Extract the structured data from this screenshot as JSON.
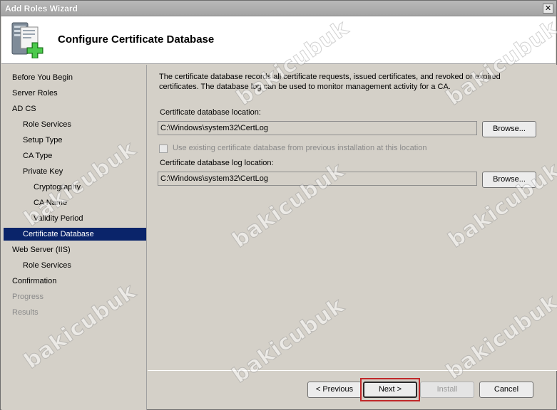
{
  "window": {
    "title": "Add Roles Wizard",
    "close_glyph": "✕"
  },
  "header": {
    "title": "Configure Certificate Database",
    "icon": "server-role-add-icon"
  },
  "sidebar": {
    "items": [
      {
        "label": "Before You Begin",
        "state": "normal"
      },
      {
        "label": "Server Roles",
        "state": "normal"
      },
      {
        "label": "AD CS",
        "state": "normal"
      },
      {
        "label": "Role Services",
        "state": "normal"
      },
      {
        "label": "Setup Type",
        "state": "normal"
      },
      {
        "label": "CA Type",
        "state": "normal"
      },
      {
        "label": "Private Key",
        "state": "normal"
      },
      {
        "label": "Cryptography",
        "state": "normal"
      },
      {
        "label": "CA Name",
        "state": "normal"
      },
      {
        "label": "Validity Period",
        "state": "normal"
      },
      {
        "label": "Certificate Database",
        "state": "selected"
      },
      {
        "label": "Web Server (IIS)",
        "state": "normal"
      },
      {
        "label": "Role Services",
        "state": "normal"
      },
      {
        "label": "Confirmation",
        "state": "normal"
      },
      {
        "label": "Progress",
        "state": "disabled"
      },
      {
        "label": "Results",
        "state": "disabled"
      }
    ]
  },
  "main": {
    "description": "The certificate database records all certificate requests, issued certificates, and revoked or expired certificates. The database log can be used to monitor management activity for a CA.",
    "db_location_label": "Certificate database location:",
    "db_location_value": "C:\\Windows\\system32\\CertLog",
    "browse_label": "Browse...",
    "use_existing_label": "Use existing certificate database from previous installation at this location",
    "log_location_label": "Certificate database log location:",
    "log_location_value": "C:\\Windows\\system32\\CertLog"
  },
  "footer": {
    "previous_label": "< Previous",
    "next_label": "Next >",
    "install_label": "Install",
    "cancel_label": "Cancel"
  },
  "watermark": {
    "text": "bakicubuk"
  },
  "colors": {
    "selection": "#0a246a",
    "highlight_box": "#c0282a"
  }
}
